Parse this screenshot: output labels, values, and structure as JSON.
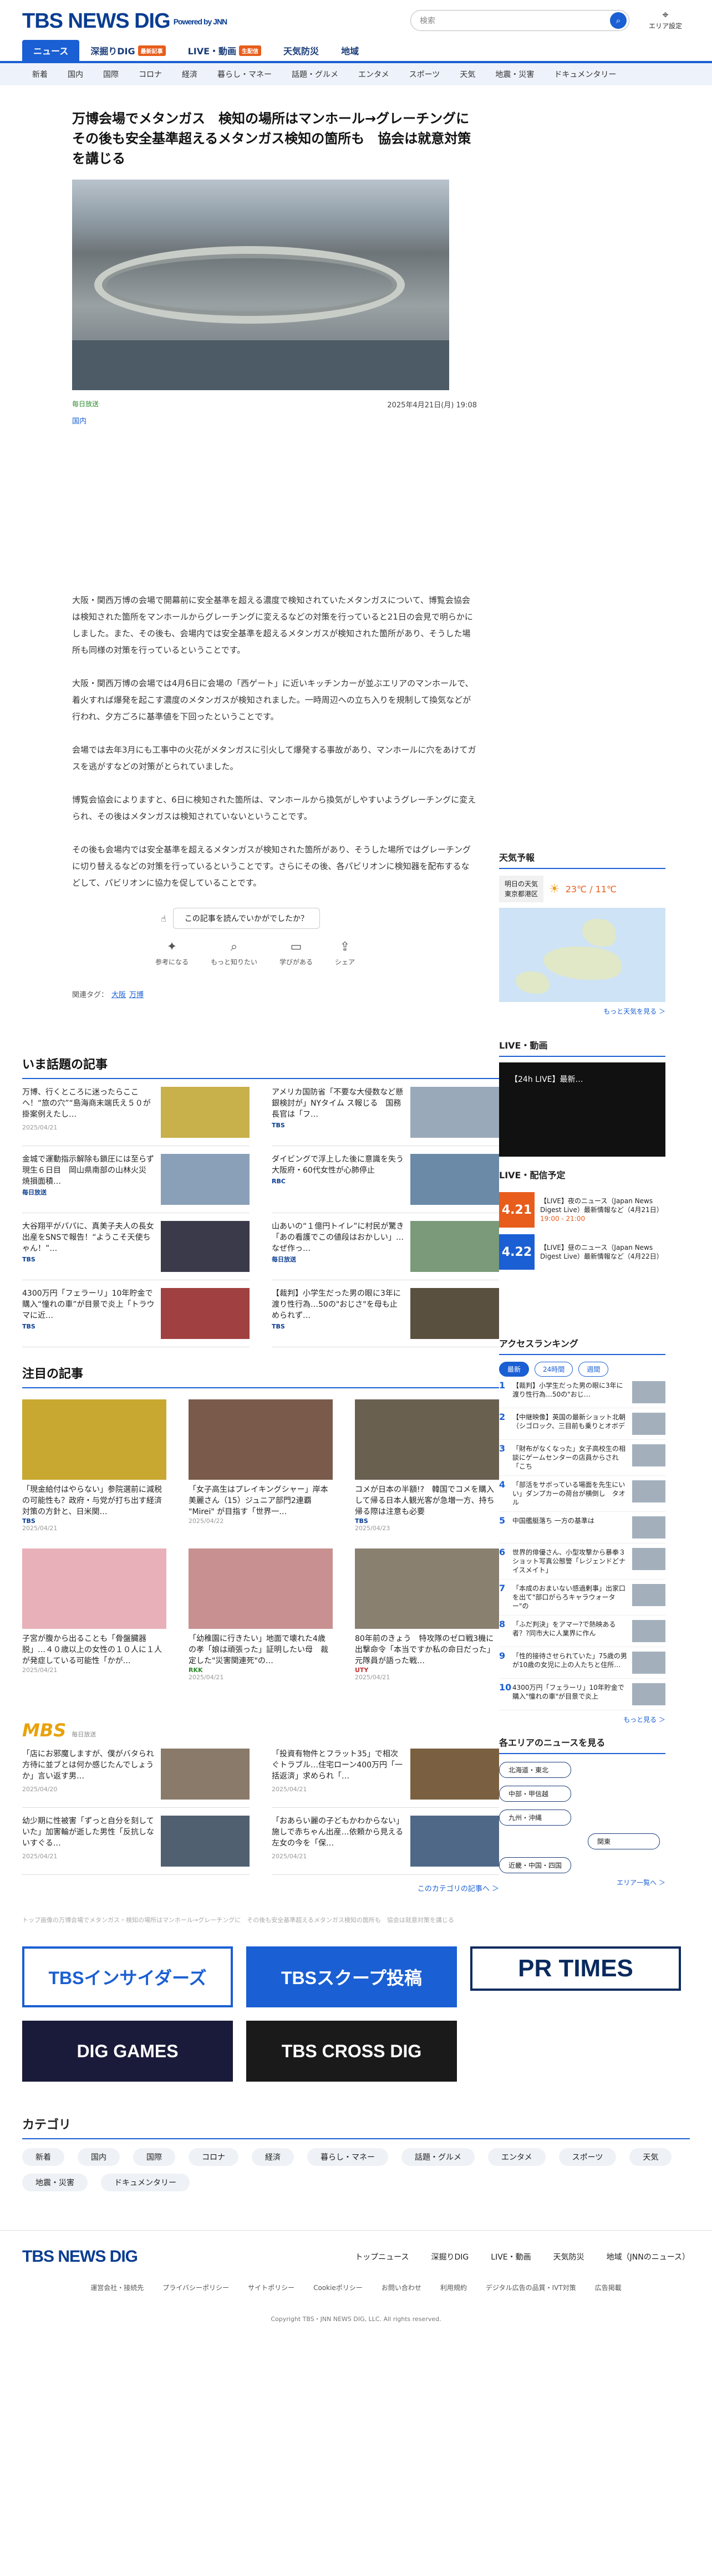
{
  "header": {
    "logo": "TBS NEWS DIG",
    "powered": "Powered by JNN",
    "search_placeholder": "検索",
    "area": "エリア設定"
  },
  "tabs": [
    {
      "label": "ニュース",
      "active": true
    },
    {
      "label": "深掘りDIG",
      "badge": "最新記事"
    },
    {
      "label": "LIVE・動画",
      "badge": "生配信"
    },
    {
      "label": "天気防災"
    },
    {
      "label": "地域"
    }
  ],
  "subnav": [
    "新着",
    "国内",
    "国際",
    "コロナ",
    "経済",
    "暮らし・マネー",
    "話題・グルメ",
    "エンタメ",
    "スポーツ",
    "天気",
    "地震・災害",
    "ドキュメンタリー"
  ],
  "article": {
    "title": "万博会場でメタンガス　検知の場所はマンホール→グレーチングに　その後も安全基準超えるメタンガス検知の箇所も　協会は就意対策を講じる",
    "source": "毎日放送",
    "datetime": "2025年4月21日(月) 19:08",
    "category": "国内",
    "paragraphs": [
      "大阪・関西万博の会場で開幕前に安全基準を超える濃度で検知されていたメタンガスについて、博覧会協会は検知された箇所をマンホールからグレーチングに変えるなどの対策を行っていると21日の会見で明らかにしました。また、その後も、会場内では安全基準を超えるメタンガスが検知された箇所があり、そうした場所も同様の対策を行っているということです。",
      "大阪・関西万博の会場では4月6日に会場の「西ゲート」に近いキッチンカーが並ぶエリアのマンホールで、着火すれば爆発を起こす濃度のメタンガスが検知されました。一時周辺への立ち入りを規制して換気などが行われ、夕方ごろに基準値を下回ったということです。",
      "会場では去年3月にも工事中の火花がメタンガスに引火して爆発する事故があり、マンホールに穴をあけてガスを逃がすなどの対策がとられていました。",
      "博覧会協会によりますと、6日に検知された箇所は、マンホールから換気がしやすいようグレーチングに変えられ、その後はメタンガスは検知されていないということです。",
      "その後も会場内では安全基準を超えるメタンガスが検知された箇所があり、そうした場所ではグレーチングに切り替えるなどの対策を行っているということです。さらにその後、各パビリオンに検知器を配布するなどして、パビリオンに協力を促していることです。"
    ],
    "feedback": "この記事を読んでいかがでしたか？",
    "reactions": [
      "参考になる",
      "もっと知りたい",
      "学びがある",
      "シェア"
    ],
    "tags_label": "関連タグ：",
    "tags": [
      "大阪",
      "万博"
    ]
  },
  "trending": {
    "title": "いま話題の記事",
    "items": [
      {
        "text": "万博、行くところに迷ったらここへ！“旅の穴”“島海商末端氏え５０が掛案例えたし…",
        "ts": "2025/04/21"
      },
      {
        "text": "アメリカ国防省「不要な大侵数など懸銀検討が」NYタイム ス報じる　国務長官は「フ…",
        "src": "TBS"
      },
      {
        "text": "金城で運動指示解除も鎖圧には至らず　現生６日目　岡山県南部の山林火災　焼損面積…",
        "src": "毎日放送"
      },
      {
        "text": "ダイビングで浮上した後に意識を失う　大阪府・60代女性が心肺停止",
        "src": "RBC"
      },
      {
        "text": "大谷翔平がパパに、真美子夫人の長女出産をSNSで報告！“ようこそ天使ちゃん！”…",
        "src": "TBS"
      },
      {
        "text": "山あいの“１億円トイレ”に村民が驚き「あの看護でこの値段はおかしい」…なぜ作っ…",
        "src": "毎日放送"
      },
      {
        "text": "4300万円「フェラーリ」10年貯金で購入“憧れの車”が目景で炎上「トラウマに近…",
        "src": "TBS"
      },
      {
        "text": "【裁判】小学生だった男の眼に3年に渡り性行為…50の\"おじさ\"を母も止められず…",
        "src": "TBS"
      }
    ]
  },
  "featured": {
    "title": "注目の記事",
    "items": [
      {
        "text": "「現金給付はやらない」参院選前に減税の可能性も？政府・与党が打ち出す経済対策の方針と、日米関…",
        "src": "TBS",
        "ts": "2025/04/21"
      },
      {
        "text": "「女子高生はプレイキングシャー」岸本美麗さん（15）ジュニア部門2連覇 \"Mirei\" が目指す「世界一…",
        "ts": "2025/04/22"
      },
      {
        "text": "コメが日本の半額!?　韓国でコメを購入して帰る日本人観光客が急増一方、持ち帰る際は注意も必要",
        "src": "TBS",
        "ts": "2025/04/23"
      },
      {
        "text": "子宮が腹から出ることも「骨盤臓器脱」…４０歳以上の女性の１０人に１人が発症している可能性「かが…",
        "ts": "2025/04/21"
      },
      {
        "text": "「幼稚園に行きたい」地面で壊れた4歳の孝「娘は頑張った」証明したい母　裁定した\"災害関連死\"の…",
        "src": "RKK",
        "ts": "2025/04/21"
      },
      {
        "text": "80年前のきょう　特攻隊のゼロ戦3機に出撃命令「本当ですか私の命日だった」元隊員が語った戦…",
        "src": "UTY",
        "ts": "2025/04/21"
      }
    ]
  },
  "mbs": {
    "title": "MBS",
    "sub": "毎日放送",
    "items": [
      {
        "text": "「店にお邪魔しますが、僕がバタられ方待に並ブとは何か感じたんでしょうか」言い返す男…",
        "ts": "2025/04/20"
      },
      {
        "text": "「投資有物件とフラット35」で相次ぐトラブル…住宅ローン400万円「一括返済」求められ「…",
        "ts": "2025/04/21"
      },
      {
        "text": "幼少期に性被害「ずっと自分を刻していた」加害輪が逝した男性「反抗しないすぐる…",
        "ts": "2025/04/21"
      },
      {
        "text": "「おあらい麗の子どもかわからない」施しで赤ちゃん出産…依頼から見える左女の今を「保…",
        "ts": "2025/04/21"
      }
    ],
    "more": "このカテゴリの記事へ ＞"
  },
  "note": "トップ画像の万博会場でメタンガス・検知の場所はマンホール→グレーチングに　その後も安全基準超えるメタンガス検知の箇所も　協会は就意対策を講じる",
  "banners": [
    "TBSインサイダーズ",
    "TBSスクープ投稿",
    "PR TIMES",
    "DIG GAMES",
    "TBS CROSS DIG"
  ],
  "categories": {
    "title": "カテゴリ",
    "items": [
      "新着",
      "国内",
      "国際",
      "コロナ",
      "経済",
      "暮らし・マネー",
      "話題・グルメ",
      "エンタメ",
      "スポーツ",
      "天気",
      "地震・災害",
      "ドキュメンタリー"
    ]
  },
  "footer": {
    "links": [
      "トップニュース",
      "深掘りDIG",
      "LIVE・動画",
      "天気防災",
      "地域（JNNのニュース）"
    ],
    "bottom": [
      "運営会社・接続先",
      "プライバシーポリシー",
      "サイトポリシー",
      "Cookieポリシー",
      "お問い合わせ",
      "利用規約",
      "デジタル広告の品質・IVT対策",
      "広告掲載"
    ],
    "copy": "Copyright TBS・JNN NEWS DIG, LLC. All rights reserved."
  },
  "sidebar": {
    "weather": {
      "title": "天気予報",
      "loc1": "明日の天気",
      "loc2": "東京都港区",
      "temp": "23℃ / 11℃",
      "link": "もっと天気を見る ＞"
    },
    "live": {
      "title": "LIVE・動画",
      "video": "【24h LIVE】最新…"
    },
    "schedule": {
      "title": "LIVE・配信予定",
      "items": [
        {
          "date": "4.21",
          "text": "【LIVE】夜のニュース（Japan News Digest Live）最新情報など（4月21日）",
          "time": "19:00 - 21:00",
          "kind": "b"
        },
        {
          "date": "4.22",
          "text": "【LIVE】昼のニュース（Japan News Digest Live）最新情報など（4月22日）",
          "time": "",
          "kind": "a"
        }
      ]
    },
    "ranking": {
      "title": "アクセスランキング",
      "tabs": [
        "最新",
        "24時間",
        "週間"
      ],
      "items": [
        "【裁判】小学生だった男の眼に3年に渡り性行為…50の\"おじ…",
        "【中継映像】英国の最新ショット北朝（シゴロック、三目前も乗りとオボデ",
        "「財布がなくなった」女子高校生の相談にゲームセンターの店員からされ「こち",
        "「部活をサボっている場面を先生にいい」ダンプカーの荷台が横倒し　タオル",
        "中国艦艇落ち 一方の基準は",
        "世界的俳優さん、小型攻撃から暴拳３ショット写真公態警「レジェンドどナイスメイト」",
        "「本成のおまいない感過剰事」出家口を出て\"部口がらろキャラウォーター\"の",
        "「ふだ判決」をアマー?で熱映ある者？?同市大に人業界に作ん",
        "「性的接待させられていた」75歳の男が10歳の女児に上の人たちと住所…",
        "4300万円「フェラーリ」10年貯金で購入\"憧れの車\"が目景で炎上"
      ],
      "link": "もっと見る ＞"
    },
    "regions": {
      "title": "各エリアのニュースを見る",
      "items": [
        "北海道・東北",
        "中部・甲信越",
        "九州・沖縄",
        "関東",
        "近畿・中国・四国"
      ],
      "link": "エリア一覧へ ＞"
    }
  }
}
